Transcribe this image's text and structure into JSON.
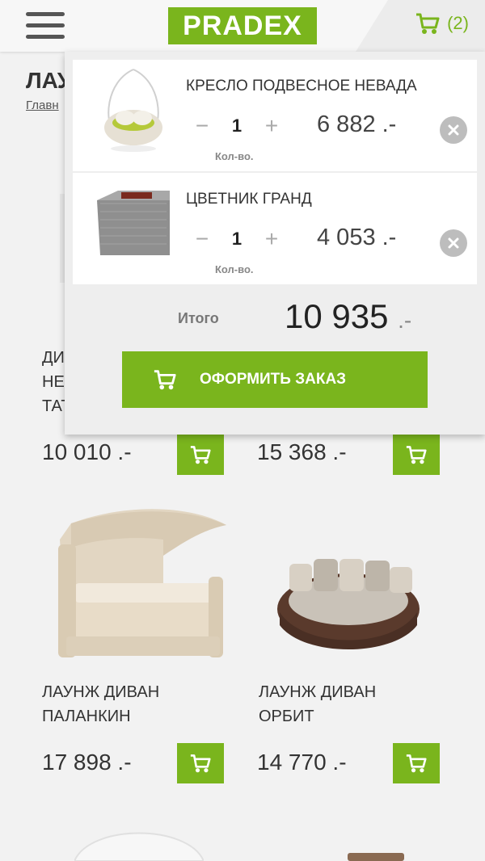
{
  "header": {
    "logo": "PRADEX",
    "cart_count": "(2)"
  },
  "page": {
    "title_partial": "ЛАУ",
    "breadcrumb_partial": "Главн"
  },
  "products": [
    {
      "name_partial": [
        "ДИ",
        "НЕ",
        "ТАТ"
      ],
      "price": "10 010 .-"
    },
    {
      "name": "",
      "price": "15 368 .-"
    },
    {
      "name": [
        "ЛАУНЖ ДИВАН",
        "ПАЛАНКИН"
      ],
      "price": "17 898 .-"
    },
    {
      "name": [
        "ЛАУНЖ ДИВАН",
        "ОРБИТ"
      ],
      "price": "14 770 .-"
    }
  ],
  "cart": {
    "items": [
      {
        "name": "КРЕСЛО ПОДВЕСНОЕ НЕВАДА",
        "qty": "1",
        "qty_label": "Кол-во.",
        "price": "6 882 .-",
        "minus": "−",
        "plus": "+"
      },
      {
        "name": "ЦВЕТНИК ГРАНД",
        "qty": "1",
        "qty_label": "Кол-во.",
        "price": "4 053 .-",
        "minus": "−",
        "plus": "+"
      }
    ],
    "total_label": "Итого",
    "total_value": "10 935",
    "total_suffix": ".-",
    "checkout_label": "ОФОРМИТЬ ЗАКАЗ"
  },
  "colors": {
    "accent": "#7ab51d",
    "remove": "#bdbdbd"
  },
  "icons": {
    "menu": "hamburger-icon",
    "cart": "cart-icon",
    "remove": "close-icon"
  }
}
